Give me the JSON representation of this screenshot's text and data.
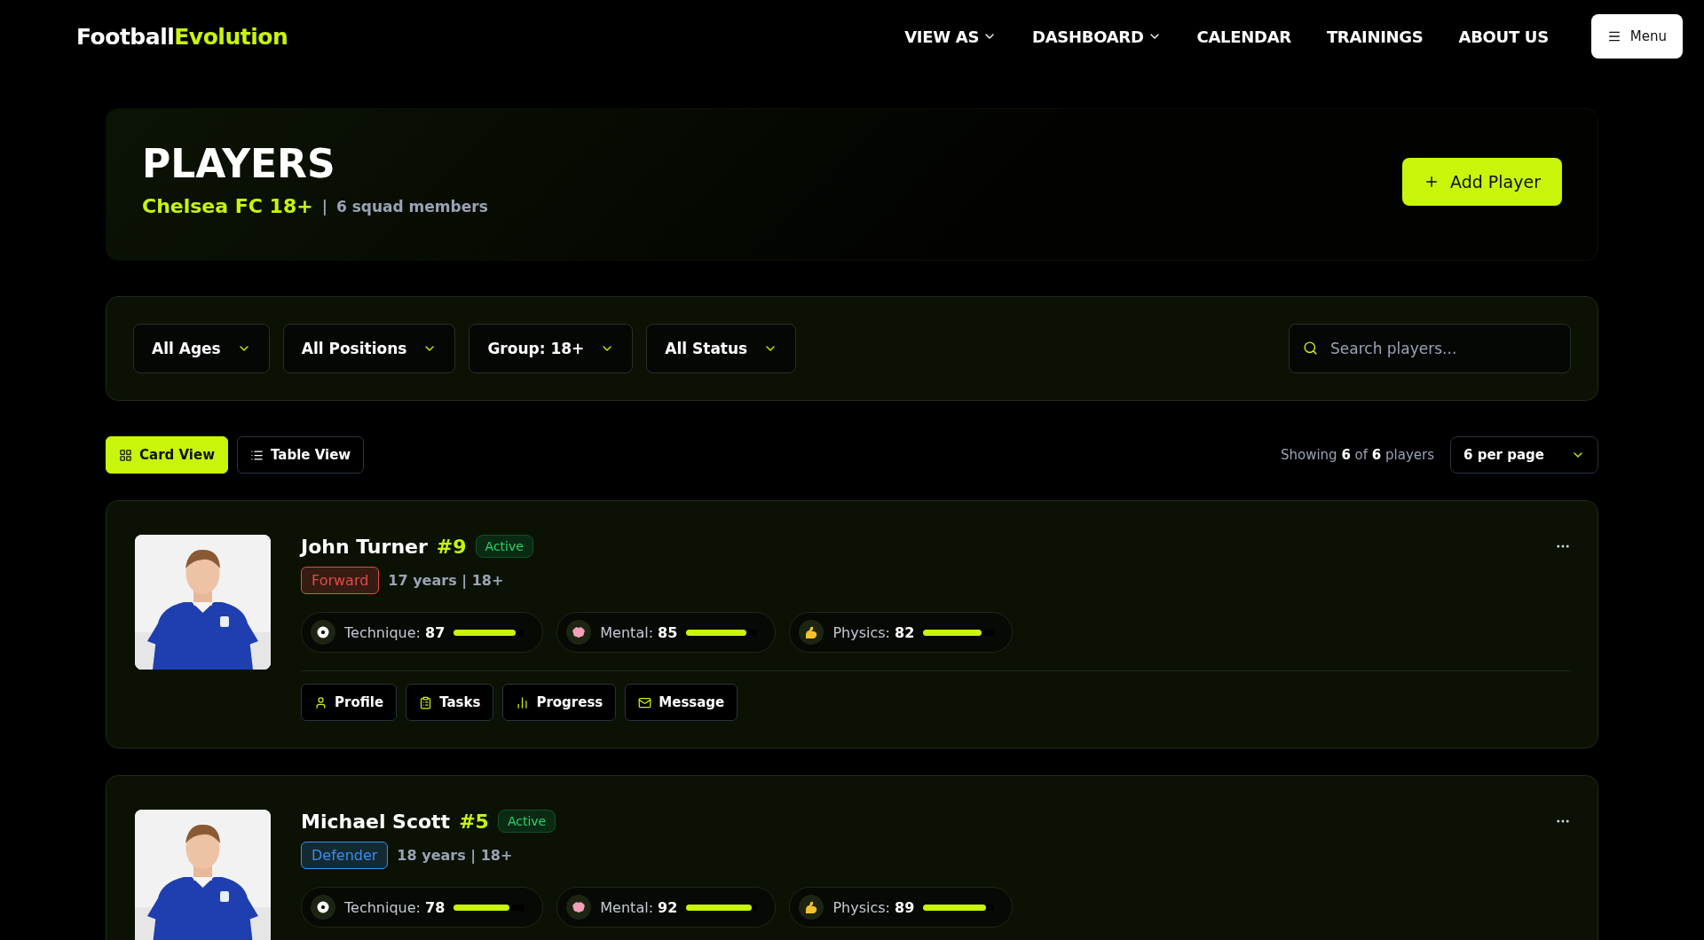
{
  "header": {
    "logo": {
      "first": "Football",
      "accent": "Evolution"
    },
    "nav": [
      {
        "label": "VIEW AS",
        "dropdown": true
      },
      {
        "label": "DASHBOARD",
        "dropdown": true
      },
      {
        "label": "CALENDAR",
        "dropdown": false
      },
      {
        "label": "TRAININGS",
        "dropdown": false
      },
      {
        "label": "ABOUT US",
        "dropdown": false
      }
    ],
    "menu_button": "Menu"
  },
  "hero": {
    "title": "PLAYERS",
    "team": "Chelsea FC 18+",
    "separator": "|",
    "members": "6 squad members",
    "add_button": "Add Player"
  },
  "filters": {
    "dropdowns": [
      "All Ages",
      "All Positions",
      "Group: 18+",
      "All Status"
    ],
    "search": {
      "placeholder": "Search players..."
    }
  },
  "toolbar": {
    "views": [
      {
        "label": "Card View",
        "kind": "grid",
        "selected": true
      },
      {
        "label": "Table View",
        "kind": "list",
        "selected": false
      }
    ],
    "showing": "Showing **6** of **6** players",
    "per_page": "6 per page"
  },
  "players": [
    {
      "name": "John Turner",
      "number": "#9",
      "status": "Active",
      "position": "Forward",
      "color": "#e5484d",
      "meta": "17 years | 18+",
      "stats": [
        {
          "kind": "ball",
          "label": "Technique:",
          "value": "87",
          "level": 0.87
        },
        {
          "kind": "brain",
          "label": "Mental:",
          "value": "85",
          "level": 0.85
        },
        {
          "kind": "muscle",
          "label": "Physics:",
          "value": "82",
          "level": 0.82
        }
      ],
      "actions": [
        {
          "kind": "profile",
          "label": "Profile"
        },
        {
          "kind": "tasks",
          "label": "Tasks"
        },
        {
          "kind": "progress",
          "label": "Progress"
        },
        {
          "kind": "message",
          "label": "Message"
        }
      ]
    },
    {
      "name": "Michael Scott",
      "number": "#5",
      "status": "Active",
      "position": "Defender",
      "color": "#3b8bf0",
      "meta": "18 years | 18+",
      "stats": [
        {
          "kind": "ball",
          "label": "Technique:",
          "value": "78",
          "level": 0.78
        },
        {
          "kind": "brain",
          "label": "Mental:",
          "value": "92",
          "level": 0.92
        },
        {
          "kind": "muscle",
          "label": "Physics:",
          "value": "89",
          "level": 0.89
        }
      ]
    }
  ]
}
